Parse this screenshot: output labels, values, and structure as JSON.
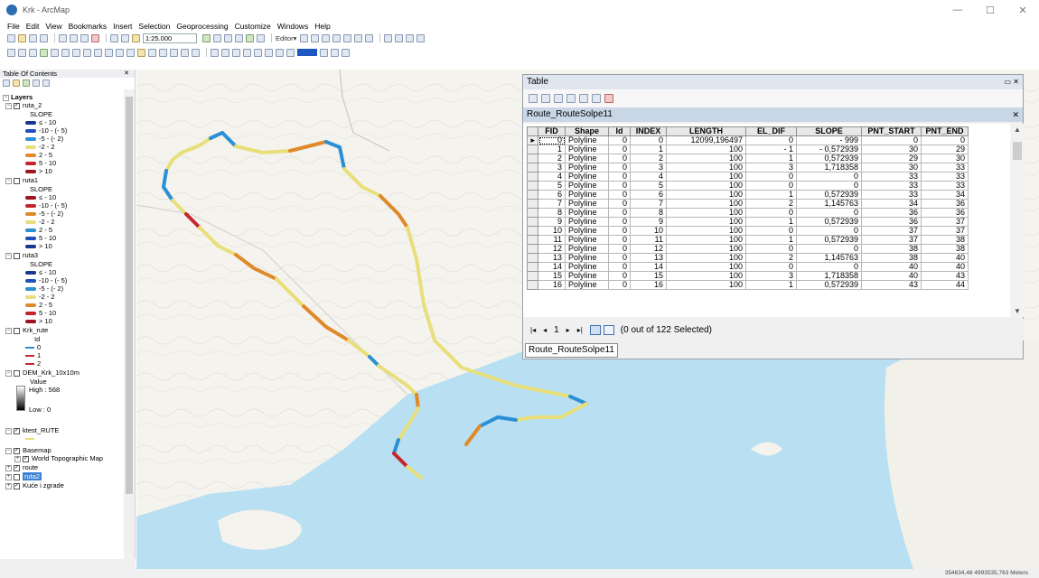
{
  "window": {
    "title": "Krk - ArcMap",
    "minimize": "—",
    "maximize": "☐",
    "close": "✕"
  },
  "menu": [
    "File",
    "Edit",
    "View",
    "Bookmarks",
    "Insert",
    "Selection",
    "Geoprocessing",
    "Customize",
    "Windows",
    "Help"
  ],
  "toolbar": {
    "scale": "1:25.000",
    "editor": "Editor▾"
  },
  "toc": {
    "title": "Table Of Contents",
    "close": "✕",
    "layers_label": "Layers",
    "ruta_2": {
      "name": "ruta_2",
      "field": "SLOPE",
      "classes": [
        "≤ - 10",
        "-10 - (- 5)",
        "-5 - (- 2)",
        "-2 - 2",
        "2 - 5",
        "5 - 10",
        "> 10"
      ]
    },
    "ruta1": {
      "name": "ruta1",
      "field": "SLOPE",
      "classes": [
        "≤ - 10",
        "-10 - (- 5)",
        "-5 - (- 2)",
        "-2 - 2",
        "2 - 5",
        "5 - 10",
        "> 10"
      ]
    },
    "ruta3": {
      "name": "ruta3",
      "field": "SLOPE",
      "classes": [
        "≤ - 10",
        "-10 - (- 5)",
        "-5 - (- 2)",
        "-2 - 2",
        "2 - 5",
        "5 - 10",
        "> 10"
      ]
    },
    "krk_rute": {
      "name": "Krk_rute",
      "field": "Id",
      "classes": [
        "0",
        "1",
        "2"
      ]
    },
    "dem": {
      "name": "DEM_Krk_10x10m",
      "value_label": "Value",
      "high": "High : 568",
      "low": "Low : 0"
    },
    "ktest": {
      "name": "ktest_RUTE"
    },
    "basemap": {
      "name": "Basemap",
      "child": "World Topographic Map"
    },
    "route": {
      "name": "route"
    },
    "ruta2": {
      "name": "ruta2"
    },
    "kuce": {
      "name": "Kuće i zgrade"
    }
  },
  "colors": {
    "red": "#c6262b",
    "orange": "#e0892a",
    "yellow": "#e9df7a",
    "blue": "#2b8fd6",
    "dark_blue": "#17368d",
    "pale": "#cfe3a2"
  },
  "table": {
    "window_title": "Table",
    "window_buttons": "▭ ✕",
    "tab_name": "Route_RouteSolpe11",
    "tab_close": "✕",
    "columns": [
      "FID",
      "Shape",
      "Id",
      "INDEX",
      "LENGTH",
      "EL_DIF",
      "SLOPE",
      "PNT_START",
      "PNT_END"
    ],
    "rows": [
      [
        "0",
        "Polyline",
        "0",
        "0",
        "12099,196497",
        "0",
        "- 999",
        "0",
        "0"
      ],
      [
        "1",
        "Polyline",
        "0",
        "1",
        "100",
        "- 1",
        "- 0,572939",
        "30",
        "29"
      ],
      [
        "2",
        "Polyline",
        "0",
        "2",
        "100",
        "1",
        "0,572939",
        "29",
        "30"
      ],
      [
        "3",
        "Polyline",
        "0",
        "3",
        "100",
        "3",
        "1,718358",
        "30",
        "33"
      ],
      [
        "4",
        "Polyline",
        "0",
        "4",
        "100",
        "0",
        "0",
        "33",
        "33"
      ],
      [
        "5",
        "Polyline",
        "0",
        "5",
        "100",
        "0",
        "0",
        "33",
        "33"
      ],
      [
        "6",
        "Polyline",
        "0",
        "6",
        "100",
        "1",
        "0,572939",
        "33",
        "34"
      ],
      [
        "7",
        "Polyline",
        "0",
        "7",
        "100",
        "2",
        "1,145763",
        "34",
        "36"
      ],
      [
        "8",
        "Polyline",
        "0",
        "8",
        "100",
        "0",
        "0",
        "36",
        "36"
      ],
      [
        "9",
        "Polyline",
        "0",
        "9",
        "100",
        "1",
        "0,572939",
        "36",
        "37"
      ],
      [
        "10",
        "Polyline",
        "0",
        "10",
        "100",
        "0",
        "0",
        "37",
        "37"
      ],
      [
        "11",
        "Polyline",
        "0",
        "11",
        "100",
        "1",
        "0,572939",
        "37",
        "38"
      ],
      [
        "12",
        "Polyline",
        "0",
        "12",
        "100",
        "0",
        "0",
        "38",
        "38"
      ],
      [
        "13",
        "Polyline",
        "0",
        "13",
        "100",
        "2",
        "1,145763",
        "38",
        "40"
      ],
      [
        "14",
        "Polyline",
        "0",
        "14",
        "100",
        "0",
        "0",
        "40",
        "40"
      ],
      [
        "15",
        "Polyline",
        "0",
        "15",
        "100",
        "3",
        "1,718358",
        "40",
        "43"
      ],
      [
        "16",
        "Polyline",
        "0",
        "16",
        "100",
        "1",
        "0,572939",
        "43",
        "44"
      ]
    ],
    "record": "1",
    "selected_text": "(0 out of 122 Selected)"
  },
  "status": {
    "coords": "354634,48  4993535,763 Meters"
  }
}
